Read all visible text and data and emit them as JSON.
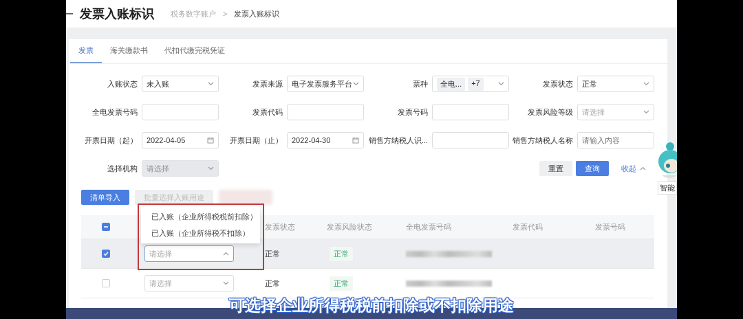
{
  "header": {
    "title": "发票入账标识",
    "breadcrumb": [
      "税务数字账户",
      "发票入账标识"
    ],
    "separator": ">"
  },
  "tabs": [
    {
      "label": "发票",
      "selected": true
    },
    {
      "label": "海关缴款书",
      "selected": false
    },
    {
      "label": "代扣代缴完税凭证",
      "selected": false
    }
  ],
  "filters": [
    {
      "label": "入账状态",
      "kind": "select",
      "value": "未入账",
      "disabled": false
    },
    {
      "label": "发票来源",
      "kind": "select",
      "value": "电子发票服务平台",
      "disabled": false
    },
    {
      "label": "票种",
      "kind": "tags",
      "tags": [
        "全电...",
        "+7"
      ],
      "disabled": false
    },
    {
      "label": "发票状态",
      "kind": "select",
      "value": "正常",
      "disabled": false
    },
    {
      "label": "全电发票号码",
      "kind": "input",
      "disabled": false
    },
    {
      "label": "发票代码",
      "kind": "input",
      "disabled": false
    },
    {
      "label": "发票号码",
      "kind": "input",
      "disabled": false
    },
    {
      "label": "发票风险等级",
      "kind": "select",
      "placeholder": "请选择",
      "disabled": false
    },
    {
      "label": "开票日期（起）",
      "kind": "date",
      "value": "2022-04-05",
      "disabled": false
    },
    {
      "label": "开票日期（止）",
      "kind": "date",
      "value": "2022-04-30",
      "disabled": false
    },
    {
      "label": "销售方纳税人识...",
      "kind": "input",
      "disabled": false
    },
    {
      "label": "销售方纳税人名称",
      "kind": "input",
      "placeholder": "请输入内容",
      "disabled": false
    },
    {
      "label": "选择机构",
      "kind": "select",
      "placeholder": "请选择",
      "disabled": true
    }
  ],
  "filter_actions": {
    "reset": "重置",
    "query": "查询",
    "collapse": "收起"
  },
  "toolbar": [
    {
      "kind": "primary",
      "label": "清单导入"
    },
    {
      "kind": "default",
      "label": "批量选择入账用途"
    },
    {
      "kind": "blurred"
    }
  ],
  "table": {
    "header_checkbox": {
      "indeterminate": true
    },
    "columns": [
      "发票状态",
      "发票风险状态",
      "全电发票号码",
      "发票代码",
      "发票号码"
    ],
    "purpose_options": [
      "已入账（企业所得税税前扣除）",
      "已入账（企业所得税不扣除）"
    ],
    "rows": [
      {
        "selected": true,
        "checked": true,
        "purpose": {
          "placeholder": "请选择",
          "expanded": true
        },
        "invoice_status": "正常",
        "risk_status": "正常"
      },
      {
        "selected": false,
        "checked": false,
        "purpose": {
          "placeholder": "请选择",
          "expanded": false
        },
        "invoice_status": "正常",
        "risk_status": "正常"
      }
    ]
  },
  "assistant": {
    "label": "智能"
  },
  "subtitle": "可选择企业所得税税前扣除或不扣除用途"
}
